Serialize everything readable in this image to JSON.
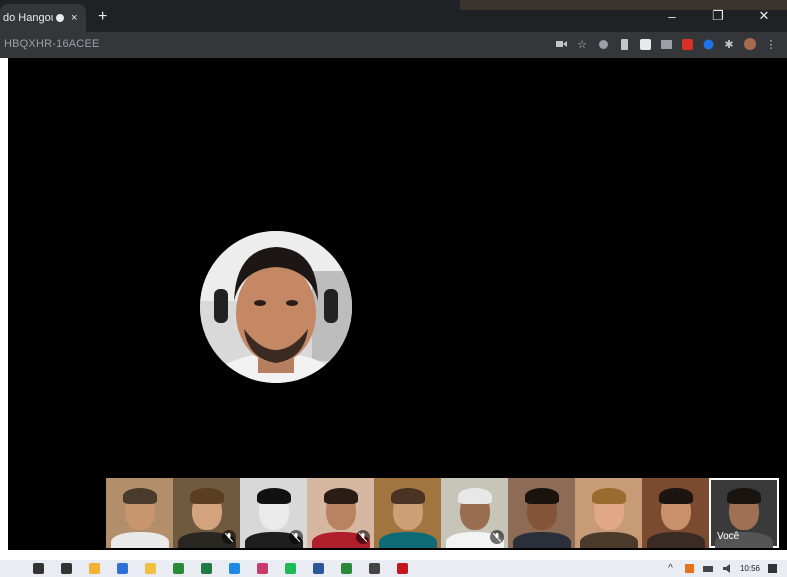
{
  "browser": {
    "tab_title": "do Hangouts",
    "tab_close": "×",
    "new_tab": "+",
    "window_controls": [
      "–",
      "❐",
      "✕"
    ],
    "url": "HBQXHR-16ACEE",
    "extension_icons": [
      "camera-icon",
      "star-icon",
      "extension-icon",
      "extension-icon",
      "extension-icon",
      "extension-icon",
      "extension-icon",
      "extension-icon",
      "puzzle-icon",
      "profile-icon",
      "menu-icon"
    ]
  },
  "call": {
    "self_label": "Você",
    "mute_icon": "mic-off-icon",
    "participants": [
      {
        "muted": false,
        "bg": "#b38e6a",
        "skin": "#c9956d",
        "hair": "#4a3a2b",
        "shirt": "#e9e9e9"
      },
      {
        "muted": true,
        "bg": "#6f5a3f",
        "skin": "#d2a37d",
        "hair": "#5b3d22",
        "shirt": "#2a2622"
      },
      {
        "muted": true,
        "bg": "#d8d8d8",
        "skin": "#eaeaea",
        "hair": "#111111",
        "shirt": "#1e1e1e"
      },
      {
        "muted": true,
        "bg": "#d6b7a1",
        "skin": "#b98261",
        "hair": "#2a1d16",
        "shirt": "#b01e2b"
      },
      {
        "muted": false,
        "bg": "#a2743f",
        "skin": "#cf9f76",
        "hair": "#4a3322",
        "shirt": "#0e6a74"
      },
      {
        "muted": true,
        "bg": "#c7c5b7",
        "skin": "#9a6f51",
        "hair": "#e8e8e8",
        "shirt": "#f3f3f3"
      },
      {
        "muted": false,
        "bg": "#8d6b55",
        "skin": "#835437",
        "hair": "#1a120d",
        "shirt": "#2b2f39"
      },
      {
        "muted": false,
        "bg": "#c79b75",
        "skin": "#e1a888",
        "hair": "#9a6a2e",
        "shirt": "#4b3a2a"
      },
      {
        "muted": false,
        "bg": "#7a4b2f",
        "skin": "#c8906b",
        "hair": "#1c1410",
        "shirt": "#3a2b24"
      }
    ]
  },
  "taskbar": {
    "icons": [
      "search-icon",
      "task-view-icon",
      "explorer-icon",
      "app-icon",
      "files-icon",
      "chrome-icon",
      "excel-icon",
      "edge-icon",
      "photos-icon",
      "spotify-icon",
      "word-icon",
      "chrome-icon",
      "calculator-icon",
      "acrobat-icon"
    ],
    "clock_time": "10:56"
  }
}
